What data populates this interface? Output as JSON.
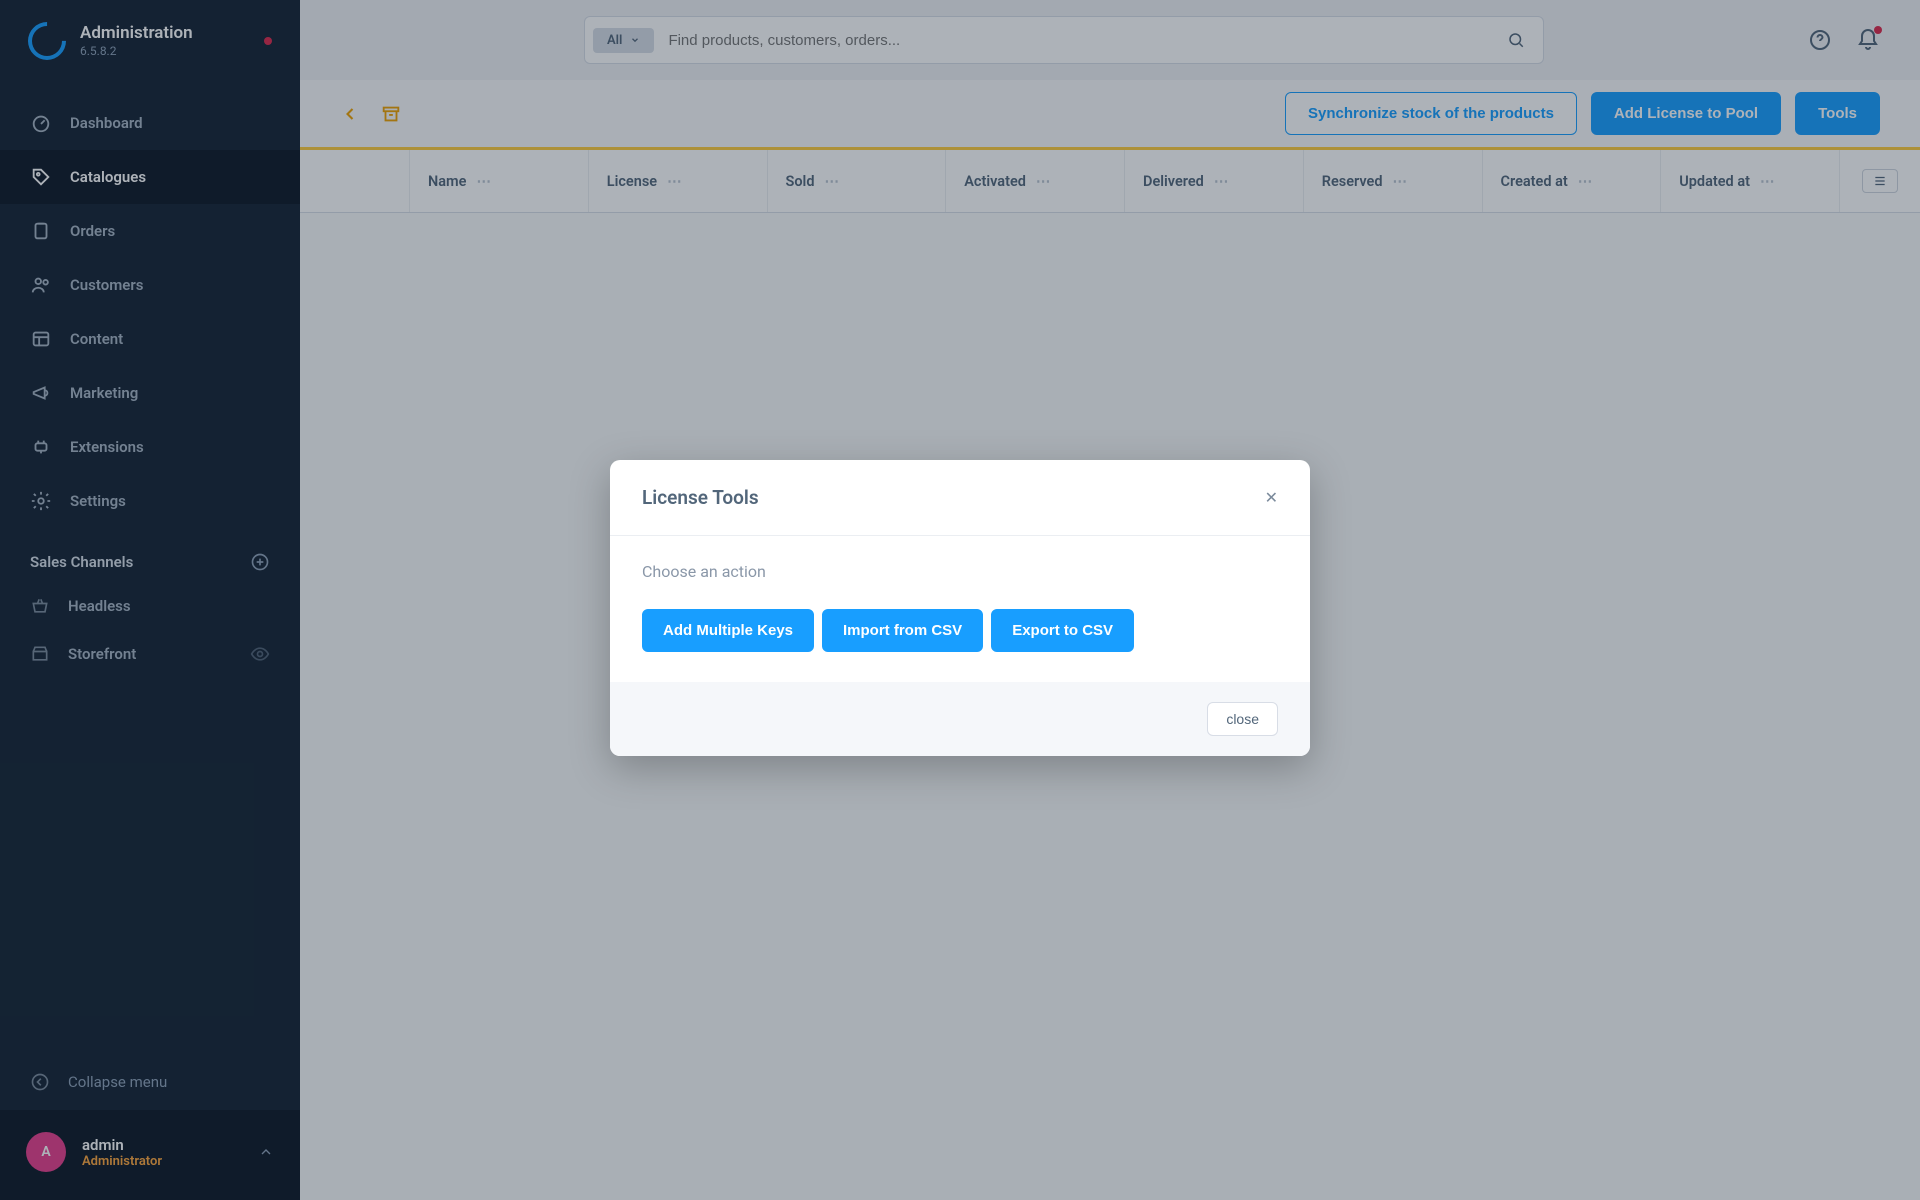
{
  "header": {
    "title": "Administration",
    "version": "6.5.8.2"
  },
  "search": {
    "filter_label": "All",
    "placeholder": "Find products, customers, orders..."
  },
  "nav": [
    {
      "label": "Dashboard"
    },
    {
      "label": "Catalogues"
    },
    {
      "label": "Orders"
    },
    {
      "label": "Customers"
    },
    {
      "label": "Content"
    },
    {
      "label": "Marketing"
    },
    {
      "label": "Extensions"
    },
    {
      "label": "Settings"
    }
  ],
  "sales_channels": {
    "heading": "Sales Channels",
    "items": [
      {
        "label": "Headless"
      },
      {
        "label": "Storefront"
      }
    ]
  },
  "collapse_label": "Collapse menu",
  "user": {
    "initial": "A",
    "name": "admin",
    "role": "Administrator"
  },
  "actions": {
    "sync": "Synchronize stock of the products",
    "add_license": "Add License to Pool",
    "tools": "Tools"
  },
  "columns": [
    "Name",
    "License",
    "Sold",
    "Activated",
    "Delivered",
    "Reserved",
    "Created at",
    "Updated at"
  ],
  "modal": {
    "title": "License Tools",
    "hint": "Choose an action",
    "buttons": {
      "add_keys": "Add Multiple Keys",
      "import_csv": "Import from CSV",
      "export_csv": "Export to CSV"
    },
    "close": "close"
  }
}
